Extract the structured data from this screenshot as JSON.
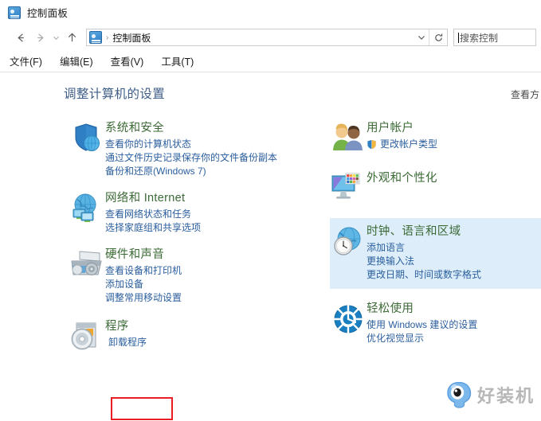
{
  "window": {
    "title": "控制面板",
    "icon": "control-panel-icon"
  },
  "navbar": {
    "back": "back-arrow-icon",
    "forward": "forward-arrow-icon",
    "recent": "chevron-down-icon",
    "up": "up-arrow-icon",
    "address": {
      "icon": "control-panel-icon",
      "separator": "›",
      "crumb": "控制面板",
      "dropdown": "chevron-down-icon",
      "refresh": "refresh-icon"
    },
    "search": {
      "placeholder": "搜索控制",
      "value": ""
    }
  },
  "menubar": {
    "items": [
      {
        "label": "文件(F)"
      },
      {
        "label": "编辑(E)"
      },
      {
        "label": "查看(V)"
      },
      {
        "label": "工具(T)"
      }
    ]
  },
  "main": {
    "heading": "调整计算机的设置",
    "view_by": "查看方"
  },
  "categories": {
    "left": [
      {
        "id": "system-and-security",
        "icon": "shield-icon",
        "title": "系统和安全",
        "links": [
          "查看你的计算机状态",
          "通过文件历史记录保存你的文件备份副本",
          "备份和还原(Windows 7)"
        ]
      },
      {
        "id": "network-and-internet",
        "icon": "globe-network-icon",
        "title": "网络和 Internet",
        "links": [
          "查看网络状态和任务",
          "选择家庭组和共享选项"
        ]
      },
      {
        "id": "hardware-and-sound",
        "icon": "printer-icon",
        "title": "硬件和声音",
        "links": [
          "查看设备和打印机",
          "添加设备",
          "调整常用移动设置"
        ]
      },
      {
        "id": "programs",
        "icon": "programs-disc-icon",
        "title": "程序",
        "links": [
          "卸载程序"
        ],
        "highlighted_link": "卸载程序"
      }
    ],
    "right": [
      {
        "id": "user-accounts",
        "icon": "users-icon",
        "title": "用户帐户",
        "links": [
          "更改帐户类型"
        ],
        "shield_links": [
          "更改帐户类型"
        ]
      },
      {
        "id": "appearance-and-personalization",
        "icon": "monitor-palette-icon",
        "title": "外观和个性化",
        "links": []
      },
      {
        "id": "clock-language-region",
        "icon": "clock-globe-icon",
        "title": "时钟、语言和区域",
        "links": [
          "添加语言",
          "更换输入法",
          "更改日期、时间或数字格式"
        ],
        "hovered": true
      },
      {
        "id": "ease-of-access",
        "icon": "ease-of-access-icon",
        "title": "轻松使用",
        "links": [
          "使用 Windows 建议的设置",
          "优化视觉显示"
        ]
      }
    ]
  },
  "watermark": {
    "text": "好装机",
    "icon": "eye-mascot-icon"
  },
  "colors": {
    "category_title": "#3c6a36",
    "link": "#2b5e9e",
    "heading": "#3f5e87",
    "highlight_border": "#ec1c24",
    "hover_background": "#ddeefa"
  }
}
